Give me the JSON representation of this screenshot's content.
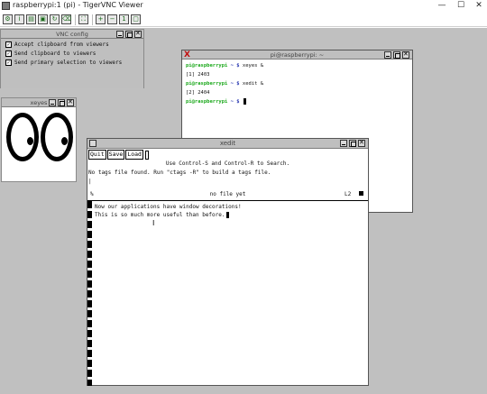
{
  "app": {
    "title": "raspberrypi:1 (pi) - TigerVNC Viewer",
    "controls": {
      "minimize": "—",
      "maximize": "☐",
      "close": "✕"
    }
  },
  "toolbar": {
    "buttons": [
      "options-icon",
      "info-icon",
      "save-icon",
      "screenshot-icon",
      "refresh-icon",
      "ctrl-alt-del-icon",
      "fullscreen-icon",
      "zoom-in-icon",
      "zoom-out-icon",
      "zoom-reset-icon",
      "zoom-fit-icon"
    ]
  },
  "vnc_config": {
    "title": "VNC config",
    "options": [
      {
        "label": "Accept clipboard from viewers",
        "checked": true
      },
      {
        "label": "Send clipboard to viewers",
        "checked": true
      },
      {
        "label": "Send primary selection to viewers",
        "checked": true
      }
    ]
  },
  "xeyes": {
    "title": "xeyes"
  },
  "lxterminal": {
    "title": "pi@raspberrypi: ~",
    "lines": [
      {
        "prompt": "pi@raspberrypi",
        "path": "~ $",
        "cmd": " xeyes &"
      },
      {
        "output": "[1] 2403"
      },
      {
        "prompt": "pi@raspberrypi",
        "path": "~ $",
        "cmd": " xedit &"
      },
      {
        "output": "[2] 2404"
      },
      {
        "prompt": "pi@raspberrypi",
        "path": "~ $",
        "cmd": " "
      }
    ]
  },
  "xedit": {
    "title": "xedit",
    "menu": {
      "quit": "Quit",
      "save": "Save",
      "load": "Load"
    },
    "messages": [
      "Use Control-S and Control-R to Search.",
      "No tags file found. Run \"ctags -R\" to build a tags file.",
      "|"
    ],
    "status": {
      "percent": "%",
      "filename": "no file yet",
      "line": "L2"
    },
    "text": [
      "Now our applications have window decorations!",
      "This is so much more useful than before."
    ]
  }
}
